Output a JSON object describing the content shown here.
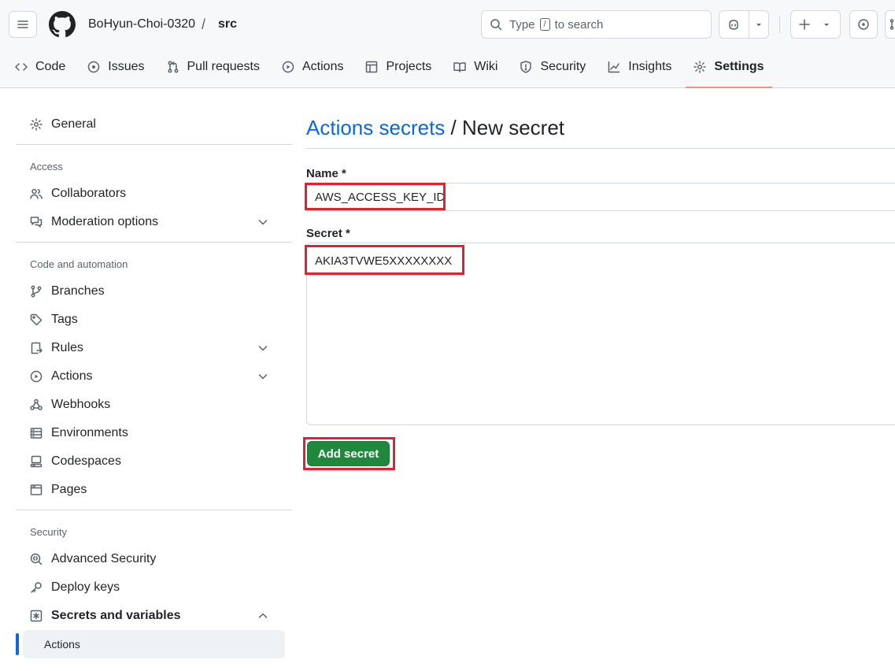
{
  "header": {
    "owner": "BoHyun-Choi-0320",
    "separator": "/",
    "repo": "src",
    "search": {
      "prefix": "Type",
      "key": "/",
      "suffix": "to search"
    }
  },
  "tabs": [
    {
      "label": "Code",
      "icon": "code-icon"
    },
    {
      "label": "Issues",
      "icon": "issue-icon"
    },
    {
      "label": "Pull requests",
      "icon": "pull-request-icon"
    },
    {
      "label": "Actions",
      "icon": "play-icon"
    },
    {
      "label": "Projects",
      "icon": "table-icon"
    },
    {
      "label": "Wiki",
      "icon": "book-icon"
    },
    {
      "label": "Security",
      "icon": "shield-icon"
    },
    {
      "label": "Insights",
      "icon": "graph-icon"
    },
    {
      "label": "Settings",
      "icon": "gear-icon",
      "active": true
    }
  ],
  "sidebar": {
    "general": "General",
    "access": {
      "title": "Access",
      "collaborators": "Collaborators",
      "moderation": "Moderation options"
    },
    "code_automation": {
      "title": "Code and automation",
      "branches": "Branches",
      "tags": "Tags",
      "rules": "Rules",
      "actions": "Actions",
      "webhooks": "Webhooks",
      "environments": "Environments",
      "codespaces": "Codespaces",
      "pages": "Pages"
    },
    "security": {
      "title": "Security",
      "advanced": "Advanced Security",
      "deploy_keys": "Deploy keys",
      "secrets_vars": "Secrets and variables",
      "secrets_actions": "Actions"
    }
  },
  "main": {
    "heading_link": "Actions secrets",
    "heading_rest": " / New secret",
    "name_label": "Name *",
    "name_value": "AWS_ACCESS_KEY_ID",
    "secret_label": "Secret *",
    "secret_value": "AKIA3TVWE5XXXXXXXX",
    "submit": "Add secret"
  },
  "colors": {
    "accent": "#0969da",
    "primary_button": "#1f883d",
    "highlight": "#e3202e",
    "active_tab_underline": "#fd8c73"
  }
}
